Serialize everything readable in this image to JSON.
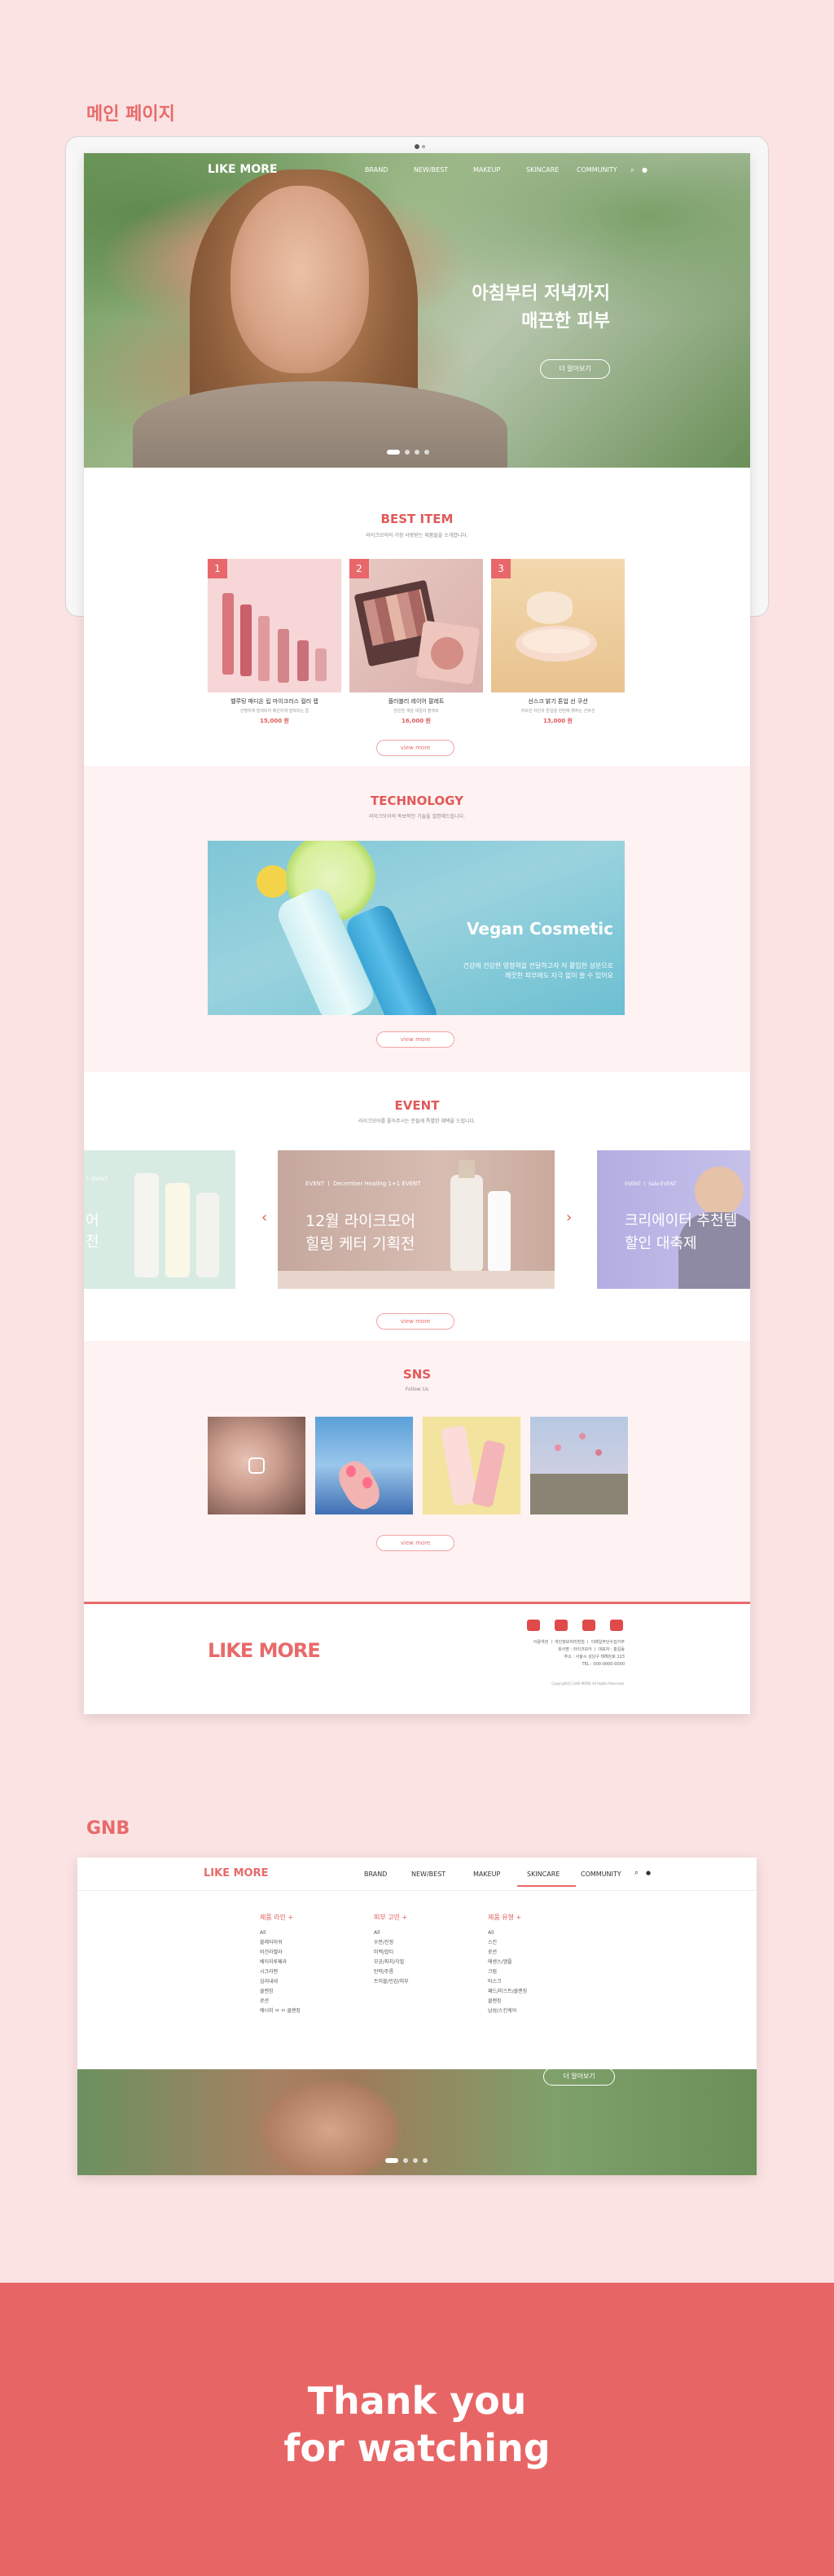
{
  "labels": {
    "main_page": "메인 페이지",
    "gnb": "GNB"
  },
  "site": {
    "logo": "LIKE MORE",
    "nav": [
      "BRAND",
      "NEW/BEST",
      "MAKEUP",
      "SKINCARE",
      "COMMUNITY"
    ],
    "hero": {
      "line1": "아침부터 저녁까지",
      "line2": "매끈한 피부",
      "button": "더 알아보기"
    },
    "best": {
      "title": "BEST ITEM",
      "subtitle": "라이크모어의 가장 사랑받는 제품들을 소개합니다.",
      "products": [
        {
          "rank": "1",
          "name": "벨루팅 매디온 립 마이크러스 컬러 랩",
          "desc": "선명하게 발색되어 매끈하게 밀착되는 립",
          "price": "15,000 원"
        },
        {
          "rank": "2",
          "name": "플러블리 레이어 팔레트",
          "desc": "은은한 색감 데일리 팔레트",
          "price": "16,000 원"
        },
        {
          "rank": "3",
          "name": "선스크 밝기 톤업 선 쿠션",
          "desc": "자외선 차단과 톤업을 한번에 해주는 선쿠션",
          "price": "13,000 원"
        }
      ],
      "more": "view more"
    },
    "tech": {
      "title": "TECHNOLOGY",
      "subtitle": "라이크모어의 독보적인 기술을 설명해드립니다.",
      "img_title": "Vegan Cosmetic",
      "img_line1": "건강에 건강한 영향력을 전달하고자 저 활입한 성분으로",
      "img_line2": "깨끗한 피부에도 자극 없이 쓸 수 있어요",
      "more": "view more"
    },
    "event": {
      "title": "EVENT",
      "subtitle": "라이크모어를 좋아주시는 분들께 특별한 혜택을 드립니다.",
      "left_tag": "ㅏ EVENT",
      "left_text1": "어",
      "left_text2": "전",
      "center_tag": "EVENT ㅣ December Healing 1+1 EVENT",
      "center_text1": "12월 라이크모어",
      "center_text2": "힐링 케터 기획전",
      "right_tag": "EVENT ㅣ Sale EVENT",
      "right_text1": "크리에이터 추천템",
      "right_text2": "할인 대축제",
      "prev": "‹",
      "next": "›",
      "more": "view more"
    },
    "sns": {
      "title": "SNS",
      "subtitle": "Follow Us",
      "more": "view more"
    },
    "footer": {
      "logo": "LIKE MORE",
      "links": "이용약관 ㅣ 개인정보처리방침 ㅣ 이메일무단수집거부",
      "address1": "회사명 : 라이크모어 ㅣ 대표자 : 홍길동",
      "address2": "주소 : 서울시 강남구 테헤란로 123",
      "tel": "TEL : 000-0000-0000",
      "copyright": "Copyright(C) LIKE MORE All Rights Reserved."
    }
  },
  "gnb": {
    "logo": "LIKE MORE",
    "nav": [
      "BRAND",
      "NEW/BEST",
      "MAKEUP",
      "SKINCARE",
      "COMMUNITY"
    ],
    "col1": {
      "head": "제품 라인 +",
      "items": [
        "All",
        "블레이미쉬",
        "비건라벨라",
        "베이지루페라",
        "시크라렌",
        "심리내네",
        "클렌징",
        "로션",
        "에너지 ㅁ ㅁ 클렌징"
      ]
    },
    "col2": {
      "head": "피부 고민 +",
      "items": [
        "All",
        "수분/진정",
        "미백/잡티",
        "모공/피지/각질",
        "탄력/주름",
        "트러블/민감/피부"
      ]
    },
    "col3": {
      "head": "제품 유형 +",
      "items": [
        "All",
        "스킨",
        "로션",
        "에센스/앰플",
        "크림",
        "마스크",
        "패드/미스트/클렌징",
        "클렌징",
        "남성/스킨케어"
      ]
    },
    "hero_button": "더 알아보기"
  },
  "thanks": {
    "line1": "Thank you",
    "line2": "for watching"
  }
}
